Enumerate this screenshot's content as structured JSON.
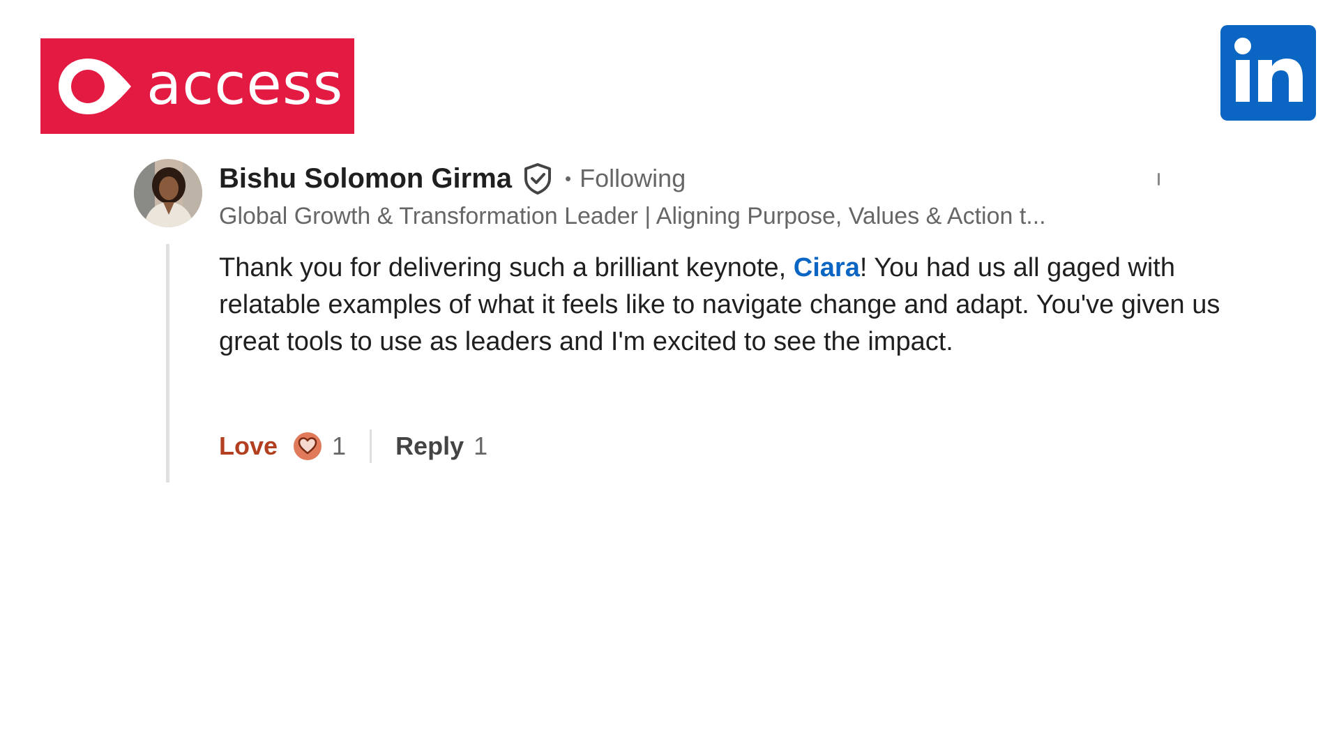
{
  "brand": {
    "access_wordmark": "access",
    "access_color": "#E31B43",
    "linkedin_color": "#0A66C2",
    "linkedin_icon": "linkedin-icon"
  },
  "comment": {
    "author_name": "Bishu Solomon Girma",
    "verified_icon": "verified-shield-icon",
    "separator": "•",
    "follow_status": "Following",
    "headline": "Global Growth & Transformation Leader | Aligning Purpose, Values & Action t...",
    "text_before_mention": "Thank you for delivering such a brilliant keynote, ",
    "mention": "Ciara",
    "text_after_mention": "! You had us all gaged with relatable examples of what it feels like to navigate change and adapt. You've given us great tools to use as leaders and I'm excited to see the impact.",
    "mention_color": "#0A66C2"
  },
  "actions": {
    "love_label": "Love",
    "love_icon": "heart-reaction-icon",
    "love_count": "1",
    "reply_label": "Reply",
    "reply_count": "1",
    "love_color": "#B24020"
  }
}
